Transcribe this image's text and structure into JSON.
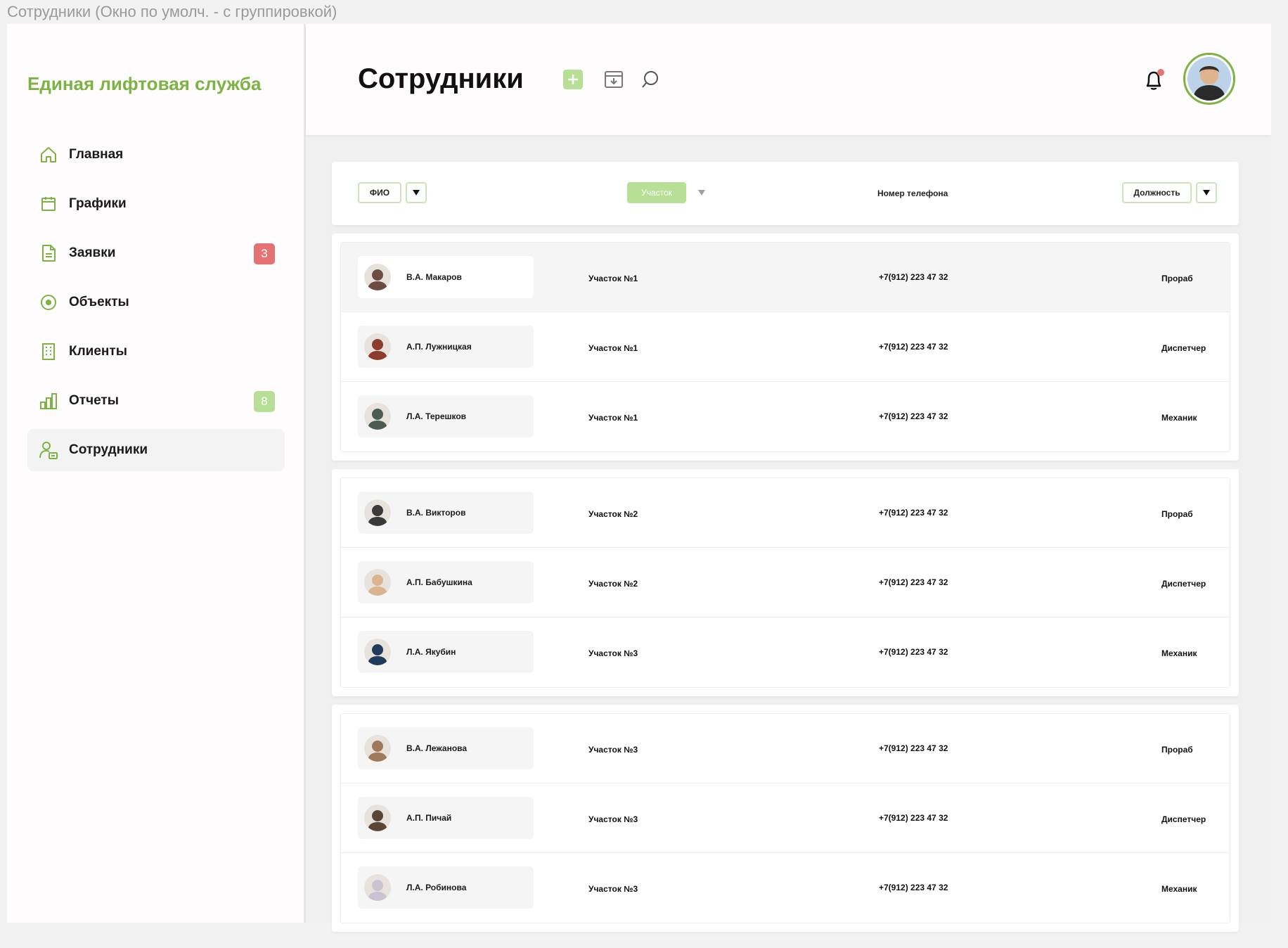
{
  "window": {
    "title": "Сотрудники (Окно по умолч. - с группировкой)"
  },
  "brand": {
    "name": "Единая лифтовая служба",
    "color": "#7cb342"
  },
  "sidebar": {
    "items": [
      {
        "label": "Главная",
        "icon": "home-icon"
      },
      {
        "label": "Графики",
        "icon": "calendar-icon"
      },
      {
        "label": "Заявки",
        "icon": "document-icon",
        "badge": "3",
        "badge_color": "#e57373"
      },
      {
        "label": "Объекты",
        "icon": "target-icon"
      },
      {
        "label": "Клиенты",
        "icon": "building-icon"
      },
      {
        "label": "Отчеты",
        "icon": "bar-chart-icon",
        "badge": "8",
        "badge_color": "#b7df96"
      },
      {
        "label": "Сотрудники",
        "icon": "employee-icon",
        "active": true
      }
    ]
  },
  "header": {
    "title": "Сотрудники",
    "actions": [
      "add-icon",
      "archive-icon",
      "search-icon"
    ],
    "notification": {
      "icon": "bell-icon",
      "has_unread": true
    },
    "profile": {
      "icon": "user-avatar"
    }
  },
  "filters": {
    "name": "ФИО",
    "area": "Участок",
    "phone": "Номер телефона",
    "role": "Должность"
  },
  "groups": [
    {
      "rows": [
        {
          "name": "В.А. Макаров",
          "area": "Участок №1",
          "phone": "+7(912) 223 47 32",
          "role": "Прораб",
          "avatar_color": "#6d4c41",
          "hover": true
        },
        {
          "name": "А.П. Лужницкая",
          "area": "Участок №1",
          "phone": "+7(912) 223 47 32",
          "role": "Диспетчер",
          "avatar_color": "#8d3b2a"
        },
        {
          "name": "Л.А. Терешков",
          "area": "Участок №1",
          "phone": "+7(912) 223 47 32",
          "role": "Механик",
          "avatar_color": "#4e5b52"
        }
      ]
    },
    {
      "rows": [
        {
          "name": "В.А. Викторов",
          "area": "Участок №2",
          "phone": "+7(912) 223 47 32",
          "role": "Прораб",
          "avatar_color": "#3a3a3a"
        },
        {
          "name": "А.П. Бабушкина",
          "area": "Участок №2",
          "phone": "+7(912) 223 47 32",
          "role": "Диспетчер",
          "avatar_color": "#d9b48f"
        },
        {
          "name": "Л.А. Якубин",
          "area": "Участок №3",
          "phone": "+7(912) 223 47 32",
          "role": "Механик",
          "avatar_color": "#1f3a5a"
        }
      ]
    },
    {
      "rows": [
        {
          "name": "В.А. Лежанова",
          "area": "Участок №3",
          "phone": "+7(912) 223 47 32",
          "role": "Прораб",
          "avatar_color": "#a0785a"
        },
        {
          "name": "А.П. Пичай",
          "area": "Участок №3",
          "phone": "+7(912) 223 47 32",
          "role": "Диспетчер",
          "avatar_color": "#5a4636"
        },
        {
          "name": "Л.А. Робинова",
          "area": "Участок №3",
          "phone": "+7(912) 223 47 32",
          "role": "Механик",
          "avatar_color": "#c9c4cf"
        }
      ]
    }
  ]
}
